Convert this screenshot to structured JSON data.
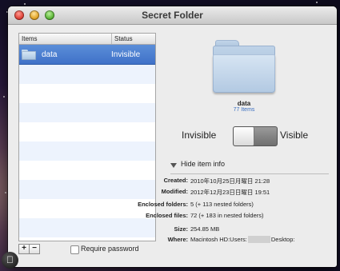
{
  "window": {
    "title": "Secret Folder"
  },
  "table": {
    "headers": {
      "items": "Items",
      "status": "Status"
    },
    "rows": [
      {
        "name": "data",
        "status": "Invisible",
        "selected": true
      }
    ]
  },
  "controls": {
    "add": "+",
    "remove": "−",
    "require_password": "Require password",
    "require_password_checked": false
  },
  "preview": {
    "name": "data",
    "item_count": "77 Items"
  },
  "visibility": {
    "left_label": "Invisible",
    "right_label": "Visible",
    "state": "Invisible"
  },
  "info": {
    "toggle_label": "Hide item info",
    "created_label": "Created:",
    "created_value": "2010年10月25日月曜日 21:28",
    "modified_label": "Modified:",
    "modified_value": "2012年12月23日日曜日 19:51",
    "enclosed_folders_label": "Enclosed folders:",
    "enclosed_folders_value": "5 (+ 113 nested folders)",
    "enclosed_files_label": "Enclosed files:",
    "enclosed_files_value": "72 (+ 183 in nested folders)",
    "size_label": "Size:",
    "size_value": "254.85 MB",
    "where_label": "Where:",
    "where_prefix": "Macintosh HD:Users:",
    "where_suffix": "Desktop:"
  },
  "colors": {
    "selection": "#3f71c8",
    "link": "#3b6fc0"
  }
}
